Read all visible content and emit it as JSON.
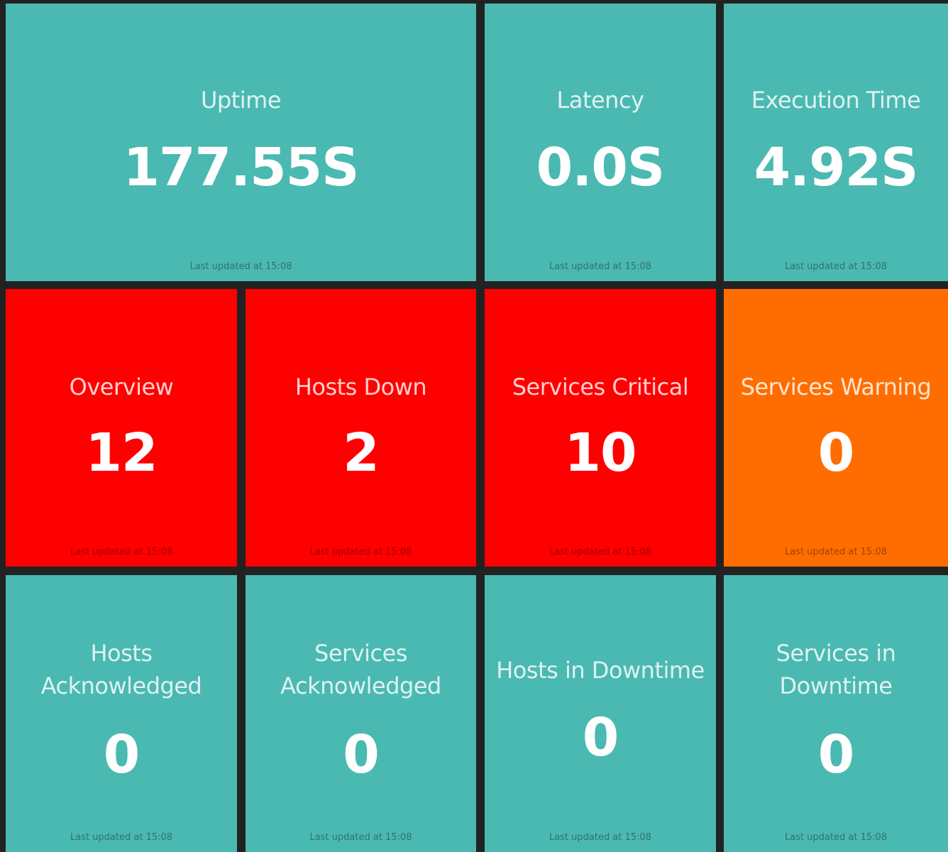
{
  "colors": {
    "background": "#222222",
    "teal": "#4ab9b1",
    "red": "#ff0000",
    "orange": "#ff6d00"
  },
  "tiles": [
    {
      "title": "Uptime",
      "value": "177.55S",
      "updated": "Last updated at 15:08",
      "status": "teal"
    },
    {
      "title": "Latency",
      "value": "0.0S",
      "updated": "Last updated at 15:08",
      "status": "teal"
    },
    {
      "title": "Execution Time",
      "value": "4.92S",
      "updated": "Last updated at 15:08",
      "status": "teal"
    },
    {
      "title": "Overview",
      "value": "12",
      "updated": "Last updated at 15:08",
      "status": "red"
    },
    {
      "title": "Hosts Down",
      "value": "2",
      "updated": "Last updated at 15:08",
      "status": "red"
    },
    {
      "title": "Services Critical",
      "value": "10",
      "updated": "Last updated at 15:08",
      "status": "red"
    },
    {
      "title": "Services Warning",
      "value": "0",
      "updated": "Last updated at 15:08",
      "status": "orange"
    },
    {
      "title": "Hosts Acknowledged",
      "value": "0",
      "updated": "Last updated at 15:08",
      "status": "teal"
    },
    {
      "title": "Services Acknowledged",
      "value": "0",
      "updated": "Last updated at 15:08",
      "status": "teal"
    },
    {
      "title": "Hosts in Downtime",
      "value": "0",
      "updated": "Last updated at 15:08",
      "status": "teal"
    },
    {
      "title": "Services in Downtime",
      "value": "0",
      "updated": "Last updated at 15:08",
      "status": "teal"
    }
  ]
}
